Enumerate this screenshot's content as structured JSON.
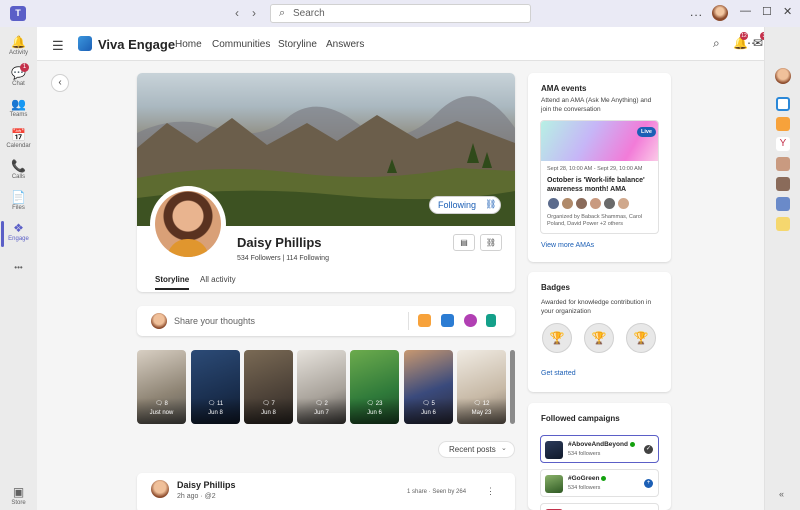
{
  "titlebar": {
    "search_placeholder": "Search",
    "more": "...",
    "window_buttons": [
      "—",
      "☐",
      "✕"
    ]
  },
  "rail": {
    "items": [
      {
        "label": "Activity",
        "icon": "bell-icon",
        "glyph": "🔔"
      },
      {
        "label": "Chat",
        "icon": "chat-icon",
        "glyph": "💬",
        "badge": "1"
      },
      {
        "label": "Teams",
        "icon": "teams-icon",
        "glyph": "👥"
      },
      {
        "label": "Calendar",
        "icon": "calendar-icon",
        "glyph": "📅"
      },
      {
        "label": "Calls",
        "icon": "phone-icon",
        "glyph": "📞"
      },
      {
        "label": "Files",
        "icon": "file-icon",
        "glyph": "📄"
      },
      {
        "label": "Engage",
        "icon": "engage-icon",
        "glyph": "❖",
        "active": true
      },
      {
        "label": "",
        "icon": "more-apps-icon",
        "glyph": "•••"
      }
    ],
    "store_label": "Store"
  },
  "appbar": {
    "app_name": "Viva Engage",
    "nav": [
      "Home",
      "Communities",
      "Storyline",
      "Answers"
    ],
    "notification_badge": "12",
    "inbox_badge": "3"
  },
  "profile": {
    "following_label": "Following",
    "name": "Daisy Phillips",
    "stats": "534 Followers  |  114 Following",
    "tabs": [
      "Storyline",
      "All activity"
    ]
  },
  "share": {
    "placeholder": "Share your thoughts"
  },
  "stories": [
    {
      "comments": "8",
      "date": "Just now"
    },
    {
      "comments": "11",
      "date": "Jun 8"
    },
    {
      "comments": "7",
      "date": "Jun 8"
    },
    {
      "comments": "2",
      "date": "Jun 7"
    },
    {
      "comments": "23",
      "date": "Jun 6"
    },
    {
      "comments": "5",
      "date": "Jun 6"
    },
    {
      "comments": "12",
      "date": "May 23"
    }
  ],
  "sort": {
    "label": "Recent posts"
  },
  "post": {
    "author": "Daisy Phillips",
    "meta": "2h ago  ·  @2",
    "stats": "1 share  ·  Seen by 264"
  },
  "ama": {
    "title": "AMA events",
    "description": "Attend an AMA (Ask Me Anything) and join the conversation",
    "live": "Live",
    "date": "Sept 28, 10:00 AM - Sept 29, 10:00 AM",
    "event_title": "October is 'Work-life balance' awareness month! AMA",
    "organizers": "Organized by Baback Shammas, Carol Poland, David Power +2 others",
    "link": "View more AMAs"
  },
  "badges": {
    "title": "Badges",
    "description": "Awarded for knowledge contribution in your organization",
    "link": "Get started"
  },
  "campaigns": {
    "title": "Followed campaigns",
    "items": [
      {
        "name": "#AboveAndBeyond",
        "followers": "534 followers",
        "color": "#2b3a5a"
      },
      {
        "name": "#GoGreen",
        "followers": "534 followers",
        "color": "#4f7b35"
      }
    ]
  },
  "colors": {
    "accent": "#5b5fc7",
    "link": "#1c5fb5",
    "badge_red": "#c4314b"
  }
}
